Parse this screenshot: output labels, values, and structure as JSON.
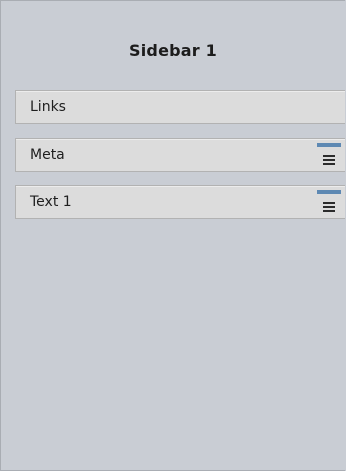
{
  "sidebar": {
    "title": "Sidebar 1",
    "widgets": [
      {
        "label": "Links",
        "has_handle": false
      },
      {
        "label": "Meta",
        "has_handle": true,
        "handle_icon": "hamburger-icon"
      },
      {
        "label": "Text 1",
        "has_handle": true,
        "handle_icon": "hamburger-icon"
      }
    ]
  },
  "colors": {
    "background": "#c9cdd4",
    "widget_background": "#dcdcdc",
    "accent": "#5e89b3"
  }
}
